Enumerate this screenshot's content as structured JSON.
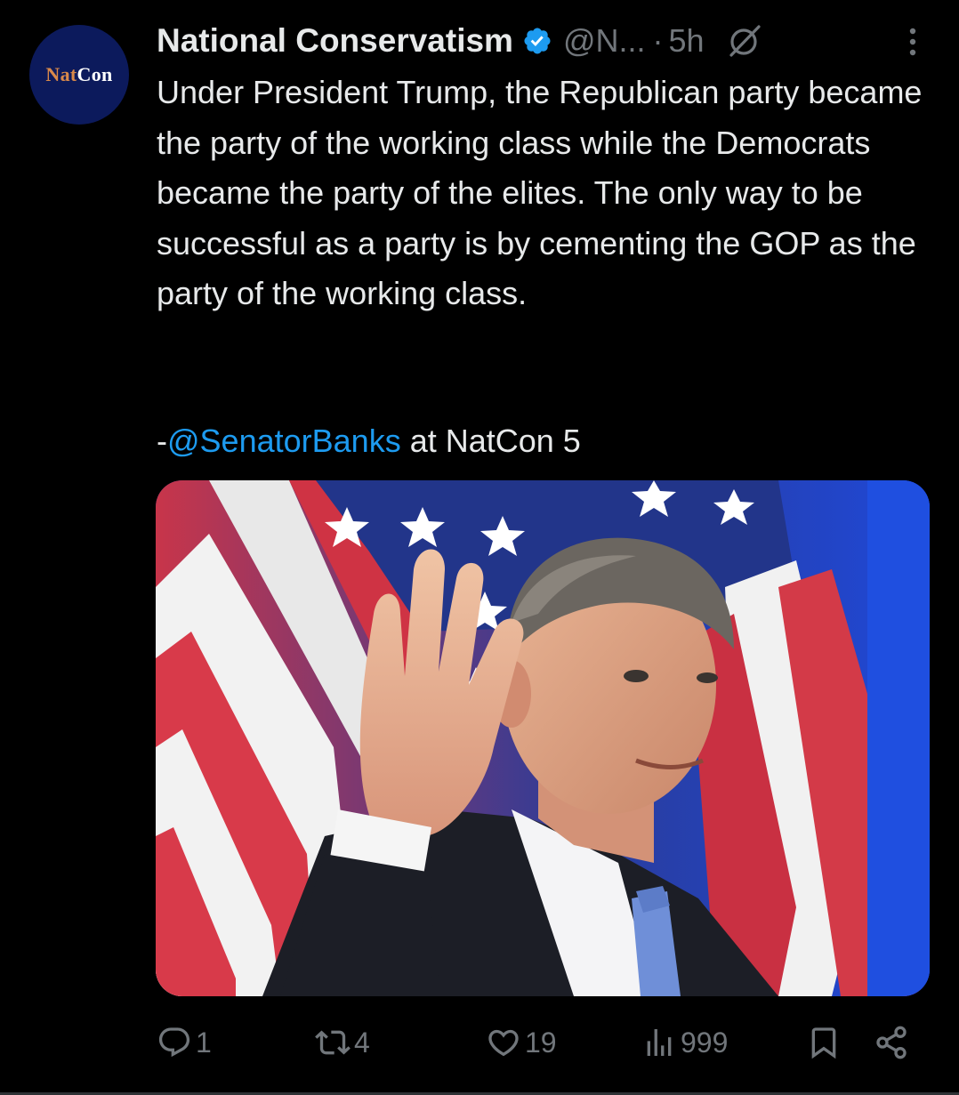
{
  "author": {
    "avatar_text_accent": "Nat",
    "avatar_text_main": "Con",
    "display_name": "National Conservatism",
    "handle": "@N...",
    "separator": "·",
    "time": "5h",
    "verified": true
  },
  "tweet": {
    "text": "Under President Trump, the Republican party became the party of the working class while the Democrats became the party of the elites. The only way to be successful as a party is by cementing the GOP as the party of the working class.",
    "attribution_prefix": "-",
    "attribution_mention": "@SenatorBanks",
    "attribution_suffix": " at NatCon 5"
  },
  "media": {
    "type": "photo"
  },
  "actions": {
    "replies": "1",
    "reposts": "4",
    "likes": "19",
    "views": "999"
  },
  "icons": {
    "verified": "verified-badge-icon",
    "grok": "grok-icon",
    "more": "more-dots-icon",
    "reply": "reply-icon",
    "repost": "repost-icon",
    "like": "heart-icon",
    "views": "views-icon",
    "bookmark": "bookmark-icon",
    "share": "share-icon"
  },
  "colors": {
    "background": "#000000",
    "text": "#e7e9ea",
    "muted": "#71767b",
    "link": "#1d9bf0",
    "avatar_bg": "#0c1a5c",
    "avatar_accent": "#d9894a"
  }
}
